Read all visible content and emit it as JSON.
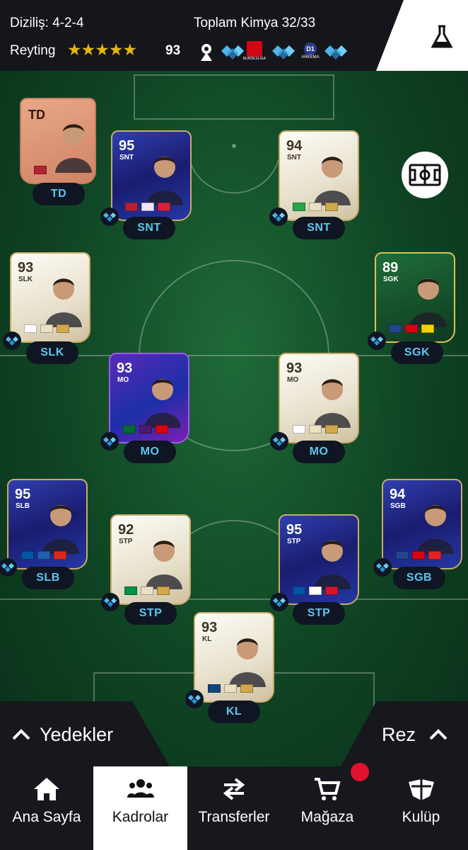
{
  "header": {
    "formation_text": "Diziliş: 4-2-4",
    "chemistry_text": "Toplam Kimya 32/33",
    "rating_label": "Reyting",
    "rating_stars": 5,
    "rating_value": "93",
    "leagues": [
      "premier-league-logo",
      "bundesliga-logo",
      "d1-arkema-logo"
    ],
    "league_texts": {
      "bundesliga": "BUNDESLIGA",
      "d1": "D1",
      "arkema": "ARKEMA"
    }
  },
  "players": [
    {
      "id": "td",
      "card_pos": "TD",
      "rating": "",
      "label": "TD",
      "theme": "t-bronze",
      "flags": [
        "#b22234"
      ],
      "chem": false
    },
    {
      "id": "snt-left",
      "card_pos": "SNT",
      "rating": "95",
      "label": "SNT",
      "theme": "t-tots",
      "flags": [
        "#b22234",
        "#f0e4ff",
        "#d8213a"
      ],
      "chem": true
    },
    {
      "id": "snt-right",
      "card_pos": "SNT",
      "rating": "94",
      "label": "SNT",
      "theme": "t-icon",
      "flags": [
        "#2aa64a",
        "#eae1c4",
        "#d2a94a"
      ],
      "chem": true
    },
    {
      "id": "slk",
      "card_pos": "SLK",
      "rating": "93",
      "label": "SLK",
      "theme": "t-icon",
      "flags": [
        "#ffffff",
        "#eae1c4",
        "#d2a94a"
      ],
      "chem": true
    },
    {
      "id": "sgk",
      "card_pos": "SGK",
      "rating": "89",
      "label": "SGK",
      "theme": "t-green",
      "flags": [
        "#21468b",
        "#d20515",
        "#f6d200"
      ],
      "chem": true
    },
    {
      "id": "mo-left",
      "card_pos": "MO",
      "rating": "93",
      "label": "MO",
      "theme": "t-fantasy",
      "flags": [
        "#046a38",
        "#4a1a6e",
        "#da020e"
      ],
      "chem": true
    },
    {
      "id": "mo-right",
      "card_pos": "MO",
      "rating": "93",
      "label": "MO",
      "theme": "t-icon",
      "flags": [
        "#ffffff",
        "#eae1c4",
        "#d2a94a"
      ],
      "chem": true
    },
    {
      "id": "slb",
      "card_pos": "SLB",
      "rating": "95",
      "label": "SLB",
      "theme": "t-tots",
      "flags": [
        "#0055a4",
        "#2060b0",
        "#da291c"
      ],
      "chem": true
    },
    {
      "id": "stp-left",
      "card_pos": "STP",
      "rating": "92",
      "label": "STP",
      "theme": "t-icon",
      "flags": [
        "#009246",
        "#eae1c4",
        "#d2a94a"
      ],
      "chem": true
    },
    {
      "id": "stp-right",
      "card_pos": "STP",
      "rating": "95",
      "label": "STP",
      "theme": "t-tots",
      "flags": [
        "#0055a4",
        "#ffffff",
        "#d2152b"
      ],
      "chem": true
    },
    {
      "id": "sgb",
      "card_pos": "SGB",
      "rating": "94",
      "label": "SGB",
      "theme": "t-tots",
      "flags": [
        "#21468b",
        "#d20515",
        "#e32221"
      ],
      "chem": true
    },
    {
      "id": "kl",
      "card_pos": "KL",
      "rating": "93",
      "label": "KL",
      "theme": "t-icon",
      "flags": [
        "#11457e",
        "#eae1c4",
        "#d2a94a"
      ],
      "chem": true
    }
  ],
  "bench": {
    "left_label": "Yedekler",
    "right_label": "Rez"
  },
  "nav": [
    {
      "id": "home",
      "label": "Ana Sayfa",
      "icon": "home-icon",
      "active": false
    },
    {
      "id": "squads",
      "label": "Kadrolar",
      "icon": "squad-icon",
      "active": true
    },
    {
      "id": "transfers",
      "label": "Transferler",
      "icon": "transfer-arrows-icon",
      "active": false
    },
    {
      "id": "store",
      "label": "Mağaza",
      "icon": "cart-icon",
      "active": false
    },
    {
      "id": "club",
      "label": "Kulüp",
      "icon": "club-icon",
      "active": false
    }
  ],
  "colors": {
    "accent_blue": "#5fc6f0",
    "gold": "#e8b415",
    "notification": "#e0122d",
    "bar": "#15161b"
  }
}
